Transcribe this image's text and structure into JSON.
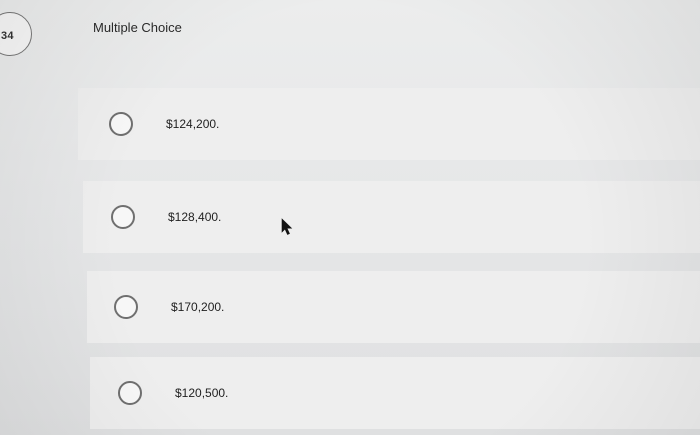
{
  "question": {
    "number": "34",
    "type_label": "Multiple Choice"
  },
  "options": [
    {
      "label": "$124,200."
    },
    {
      "label": "$128,400."
    },
    {
      "label": "$170,200."
    },
    {
      "label": "$120,500."
    }
  ],
  "icons": {
    "cursor": "mouse-pointer-icon",
    "radio": "radio-unselected-icon"
  },
  "colors": {
    "background": "#e8e9ea",
    "option_row": "#eeeeee",
    "radio_border": "#6f6f6f",
    "text": "#1f1f1f"
  }
}
